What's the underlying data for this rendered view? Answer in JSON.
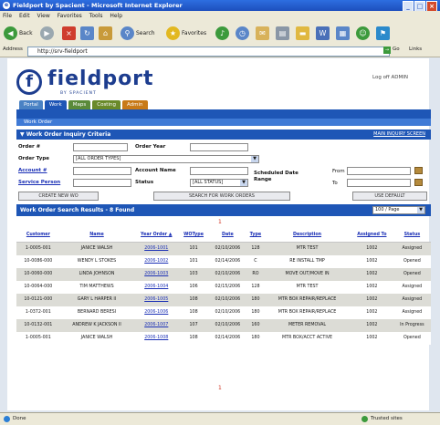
{
  "window": {
    "title": "Fieldport by Spacient - Microsoft Internet Explorer"
  },
  "menu": [
    "File",
    "Edit",
    "View",
    "Favorites",
    "Tools",
    "Help"
  ],
  "toolbar": {
    "back": "Back",
    "search": "Search",
    "favorites": "Favorites"
  },
  "address": {
    "label": "Address",
    "value": "http://srv-fieldport",
    "go": "Go",
    "links": "Links"
  },
  "app": {
    "logo": "fieldport",
    "logo_sub": "BY SPACIENT",
    "logout": "Log off ADMIN",
    "tabs": [
      "Portal",
      "Work",
      "Maps",
      "Costing",
      "Admin"
    ],
    "subnav": "Work Order"
  },
  "criteria": {
    "header": "Work Order Inquiry Criteria",
    "header_link": "MAIN INQUIRY SCREEN",
    "order_no": "Order #",
    "order_year": "Order Year",
    "order_type": "Order Type",
    "order_type_value": "[ALL ORDER TYPES]",
    "account_no": "Account #",
    "account_name": "Account Name",
    "service_person": "Service Person",
    "status": "Status",
    "status_value": "[ALL STATUS]",
    "scheduled_date_range": "Scheduled Date Range",
    "from": "From",
    "to": "To",
    "create_btn": "CREATE NEW WO",
    "search_btn": "SEARCH FOR WORK ORDERS",
    "default_btn": "USE DEFAULT"
  },
  "results": {
    "header": "Work Order Search Results - 8 Found",
    "page_size": "100 / Page",
    "pager_top": "1",
    "pager_bottom": "1",
    "columns": [
      "Customer",
      "Name",
      "Year Order",
      "WOType",
      "Date",
      "Type",
      "Description",
      "Assigned To",
      "Status"
    ],
    "rows": [
      [
        "1-0005-001",
        "JANICE WALSH",
        "2006-1001",
        "101",
        "02/10/2006",
        "128",
        "MTR TEST",
        "1002",
        "Assigned"
      ],
      [
        "10-0086-000",
        "WENDY L STOKES",
        "2006-1002",
        "101",
        "02/14/2006",
        "C",
        "RE INSTALL TMP",
        "1002",
        "Opened"
      ],
      [
        "10-0060-000",
        "LINDA JOHNSON",
        "2006-1003",
        "103",
        "02/10/2006",
        "RO",
        "MOVE OUT/MOVE IN",
        "1002",
        "Opened"
      ],
      [
        "10-0064-000",
        "TIM MATTHEWS",
        "2006-1004",
        "106",
        "02/15/2006",
        "128",
        "MTR TEST",
        "1002",
        "Assigned"
      ],
      [
        "10-0121-000",
        "GARY L HARPER II",
        "2006-1005",
        "108",
        "02/10/2006",
        "180",
        "MTR BOX REPAIR/REPLACE",
        "1002",
        "Assigned"
      ],
      [
        "1-0372-001",
        "BERNARD BERESI",
        "2006-1006",
        "108",
        "02/10/2006",
        "180",
        "MTR BOX REPAIR/REPLACE",
        "1002",
        "Assigned"
      ],
      [
        "10-0132-001",
        "ANDREW K JACKSON II",
        "2006-1007",
        "107",
        "02/10/2006",
        "160",
        "METER REMOVAL",
        "1002",
        "In Progress"
      ],
      [
        "1-0005-001",
        "JANICE WALSH",
        "2006-1008",
        "108",
        "02/14/2006",
        "180",
        "MTR BOX/ACCT ACTIVE",
        "1002",
        "Opened"
      ]
    ]
  },
  "status": {
    "left": "Done",
    "right": "Trusted sites"
  },
  "colors": {
    "nav_blue": "#1e56b6",
    "tab_green": "#5a8a3a",
    "tab_orange": "#c87a18",
    "link": "#1a2fb5"
  }
}
